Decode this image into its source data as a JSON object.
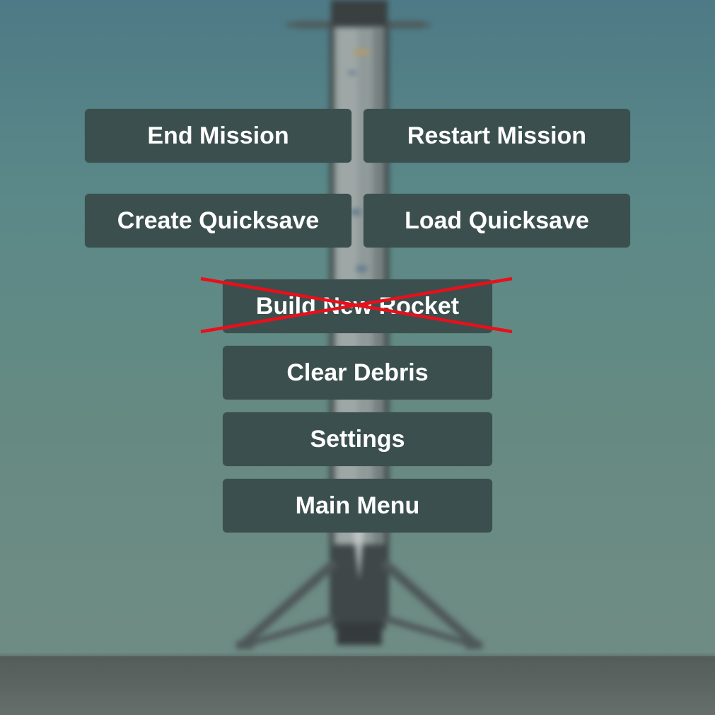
{
  "pause_menu": {
    "end_mission": "End Mission",
    "restart_mission": "Restart Mission",
    "create_quicksave": "Create Quicksave",
    "load_quicksave": "Load Quicksave",
    "build_new_rocket": "Build New Rocket",
    "build_new_rocket_disabled": true,
    "clear_debris": "Clear Debris",
    "settings": "Settings",
    "main_menu": "Main Menu"
  },
  "colors": {
    "button_bg": "#3b4f4f",
    "button_text": "#ffffff",
    "strike_mark": "#e8101a",
    "sky": "#5b8988",
    "ground": "#5d6563"
  }
}
